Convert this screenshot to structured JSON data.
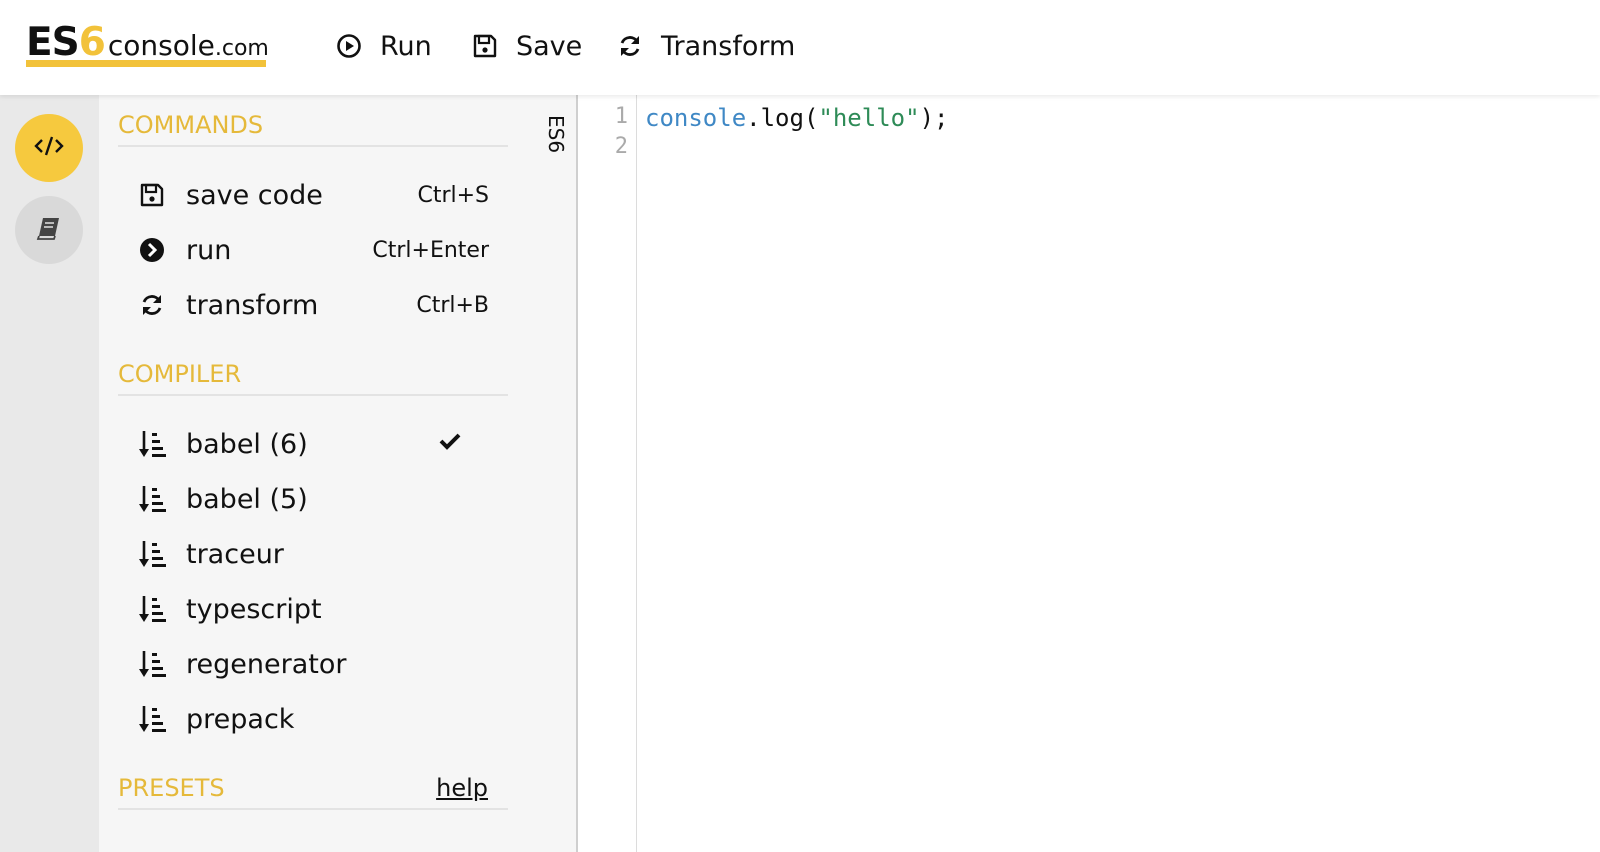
{
  "logo": {
    "es": "ES",
    "six": "6",
    "console": "console",
    "com": ".com"
  },
  "toolbar": {
    "run_label": "Run",
    "save_label": "Save",
    "transform_label": "Transform"
  },
  "sidebar": {
    "commands_heading": "COMMANDS",
    "commands": [
      {
        "label": "save code",
        "shortcut": "Ctrl+S",
        "icon": "save-icon"
      },
      {
        "label": "run",
        "shortcut": "Ctrl+Enter",
        "icon": "play-circle-icon"
      },
      {
        "label": "transform",
        "shortcut": "Ctrl+B",
        "icon": "refresh-icon"
      }
    ],
    "compiler_heading": "COMPILER",
    "compilers": [
      {
        "label": "babel (6)",
        "selected": true,
        "icon": "sort-icon"
      },
      {
        "label": "babel (5)",
        "selected": false,
        "icon": "sort-icon"
      },
      {
        "label": "traceur",
        "selected": false,
        "icon": "sort-icon"
      },
      {
        "label": "typescript",
        "selected": false,
        "icon": "sort-icon"
      },
      {
        "label": "regenerator",
        "selected": false,
        "icon": "sort-icon"
      },
      {
        "label": "prepack",
        "selected": false,
        "icon": "sort-icon"
      }
    ],
    "presets_heading": "PRESETS",
    "help_label": "help"
  },
  "strip": {
    "label": "ES6"
  },
  "editor": {
    "line_numbers": [
      "1",
      "2"
    ],
    "code_tokens": {
      "obj": "console",
      "rest": ".log(",
      "str": "\"hello\"",
      "end": ");"
    }
  },
  "colors": {
    "accent": "#f2c23a",
    "heading": "#e5b93a",
    "code_var": "#3f88c5",
    "code_string": "#2e8b57"
  }
}
